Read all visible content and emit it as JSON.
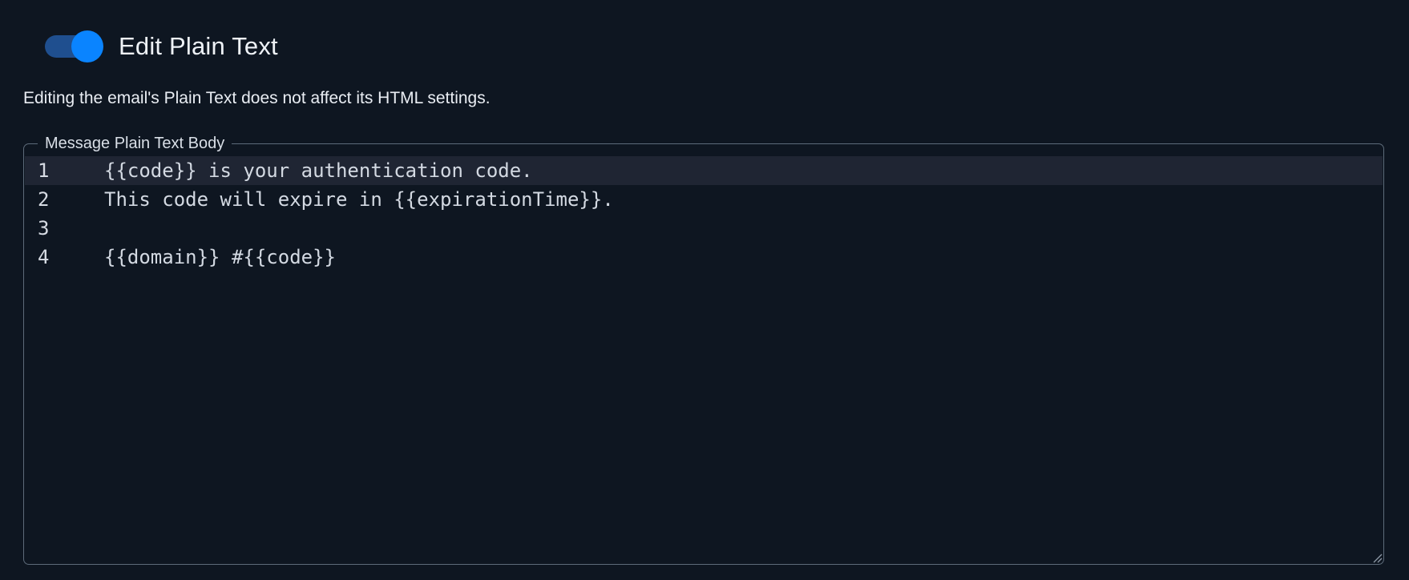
{
  "toggle": {
    "label": "Edit Plain Text",
    "checked": true,
    "accent_color": "#0a84ff",
    "track_color": "#1f4f8f"
  },
  "helper_text": "Editing the email's Plain Text does not affect its HTML settings.",
  "editor": {
    "legend": "Message Plain Text Body",
    "lines": [
      {
        "number": "1",
        "text": "{{code}} is your authentication code."
      },
      {
        "number": "2",
        "text": "This code will expire in {{expirationTime}}."
      },
      {
        "number": "3",
        "text": ""
      },
      {
        "number": "4",
        "text": "{{domain}} #{{code}}"
      }
    ],
    "active_line": 1
  },
  "colors": {
    "background": "#0e1621",
    "border": "#5d6b7a",
    "active_line": "#1f2533"
  }
}
